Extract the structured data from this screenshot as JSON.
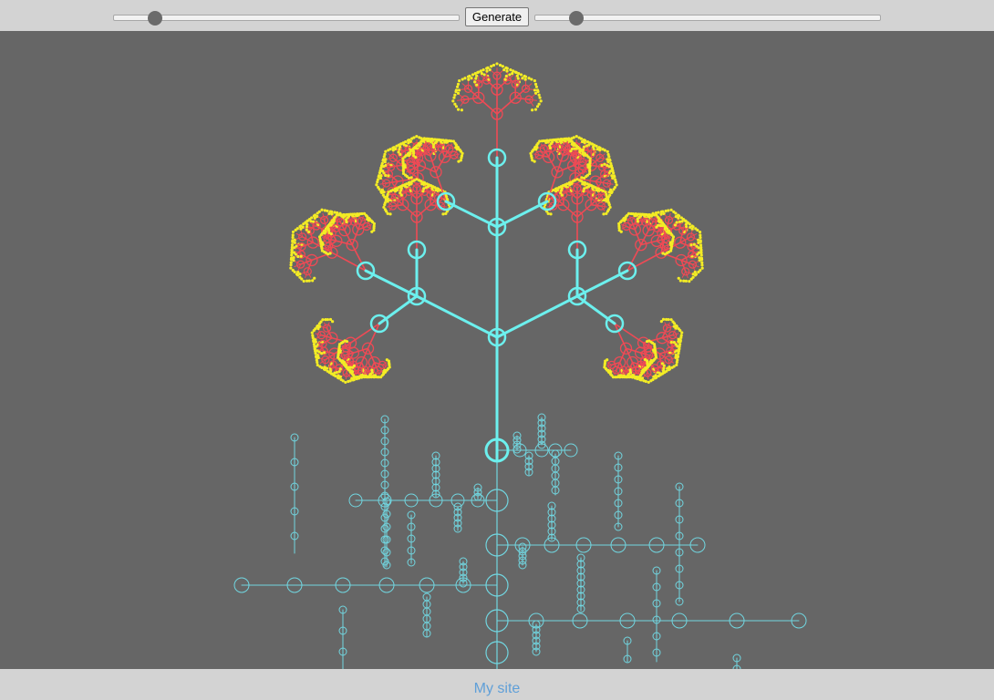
{
  "toolbar": {
    "generate_label": "Generate",
    "slider_left_value": 0.12,
    "slider_right_value": 0.12
  },
  "footer": {
    "link_text": "My site"
  },
  "colors": {
    "canvas_bg": "#666666",
    "trunk": "#6cf0ee",
    "branch": "#ef4a55",
    "leaf": "#f3ec25",
    "roots": "#71d6e0",
    "link": "#5f9fd8"
  }
}
